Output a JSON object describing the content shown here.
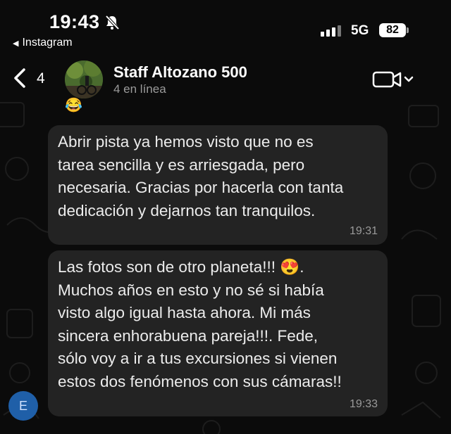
{
  "status_bar": {
    "time": "19:43",
    "back_app": "Instagram",
    "network": "5G",
    "battery": "82",
    "icons": [
      "bell-slash-icon",
      "signal-icon"
    ]
  },
  "header": {
    "unread_count": "4",
    "title": "Staff Altozano 500",
    "subtitle": "4 en línea",
    "icons": [
      "chevron-left-icon",
      "video-call-icon",
      "chevron-down-icon"
    ]
  },
  "messages": [
    {
      "text": "Abrir pista ya hemos visto que no es\ntarea sencilla y es arriesgada, pero\nnecesaria. Gracias por hacerla con tanta\ndedicación y dejarnos tan tranquilos.",
      "time": "19:31"
    },
    {
      "text": "Las fotos son de otro planeta!!! 😍.\nMuchos años en esto y no sé si había\nvisto algo igual hasta ahora. Mi más\nsincera enhorabuena pareja!!!. Fede,\nsólo voy a ir a tus excursiones si vienen\nestos dos fenómenos con sus cámaras!!",
      "time": "19:33",
      "sender_initial": "E"
    }
  ],
  "peek_emoji": "😂",
  "colors": {
    "background": "#0b0b0b",
    "bubble": "#232323",
    "avatar_sender": "#1f5fa8"
  }
}
